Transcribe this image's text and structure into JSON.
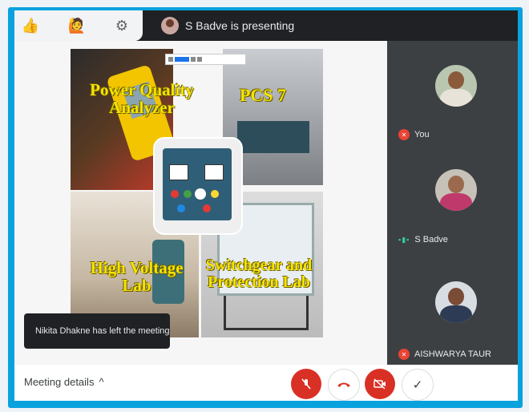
{
  "reactions": {
    "thumbs": "👍",
    "raise_hand": "🙋",
    "settings": "⚙"
  },
  "presenter_banner": "S Badve is presenting",
  "slide": {
    "labels": {
      "pqa": "Power Quality Analyzer",
      "pcs": "PCS 7",
      "hv": "High Voltage Lab",
      "sw": "Switchgear and Protection Lab"
    }
  },
  "toast": "Nikita Dhakne has left the meeting",
  "participants": [
    {
      "name": "You",
      "status": "muted"
    },
    {
      "name": "S Badve",
      "status": "speaking"
    },
    {
      "name": "AISHWARYA TAUR",
      "status": "muted"
    }
  ],
  "bottom": {
    "meeting_details": "Meeting details",
    "chevron": "^"
  },
  "icons": {
    "mic_off": "mic-off-icon",
    "end_call": "end-call-icon",
    "camera_off": "camera-off-icon",
    "check": "check-icon"
  },
  "colors": {
    "frame": "#0aa2de",
    "dark": "#202124",
    "red": "#d93025",
    "label": "#f5e400"
  }
}
